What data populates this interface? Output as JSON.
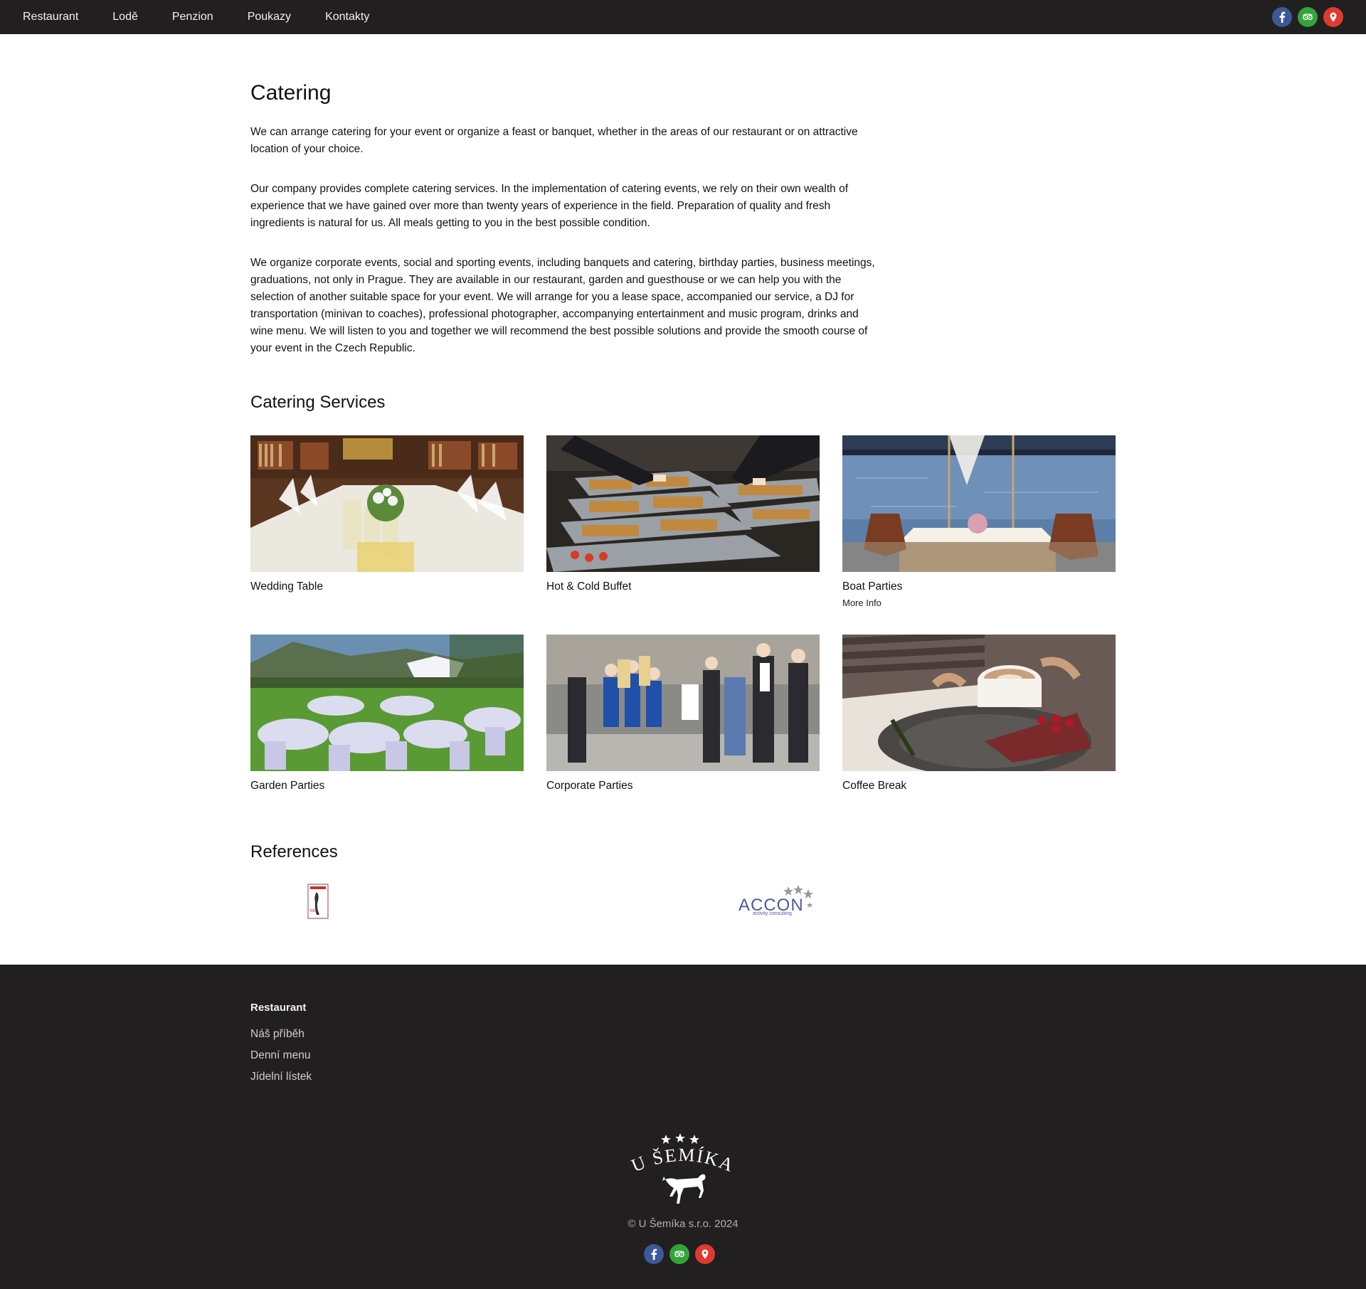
{
  "nav": {
    "items": [
      "Restaurant",
      "Lodě",
      "Penzion",
      "Poukazy",
      "Kontakty"
    ]
  },
  "social": [
    {
      "name": "facebook-icon",
      "color": "#3b5998"
    },
    {
      "name": "tripadvisor-icon",
      "color": "#34a43a"
    },
    {
      "name": "map-pin-icon",
      "color": "#e03a2f"
    }
  ],
  "page": {
    "title": "Catering",
    "paragraphs": [
      "We can arrange catering for your event or organize a feast or banquet, whether in the areas of our restaurant or on attractive location of your choice.",
      "Our company provides complete catering services. In the implementation of catering events, we rely on their own wealth of experience that we have gained over more than twenty years of experience in the field. Preparation of quality and fresh ingredients is natural for us. All meals getting to you in the best possible condition.",
      "We organize corporate events, social and sporting events, including banquets and catering, birthday parties, business meetings, graduations, not only in Prague. They are available in our restaurant, garden and guesthouse or we can help you with the selection of another suitable space for your event. We will arrange for you a lease space, accompanied our service, a DJ for transportation (minivan to coaches), professional photographer, accompanying entertainment and music program, drinks and wine menu. We will listen to you and together we will recommend the best possible solutions and provide the smooth course of your event in the Czech Republic."
    ],
    "services_heading": "Catering Services",
    "services": [
      {
        "title": "Wedding Table",
        "more": ""
      },
      {
        "title": "Hot & Cold Buffet",
        "more": ""
      },
      {
        "title": "Boat Parties",
        "more": "More Info"
      },
      {
        "title": "Garden Parties",
        "more": ""
      },
      {
        "title": "Corporate Parties",
        "more": ""
      },
      {
        "title": "Coffee Break",
        "more": ""
      }
    ],
    "references_heading": "References",
    "references": [
      {
        "name": "reference-logo-1",
        "text": ""
      },
      {
        "name": "accon-logo",
        "text": "ACCON activity consulting"
      }
    ]
  },
  "footer": {
    "column_heading": "Restaurant",
    "links": [
      "Náš příběh",
      "Denní menu",
      "Jídelní lístek"
    ],
    "logo_text": "U ŠEMÍKA",
    "copyright": "© U Šemíka s.r.o. 2024"
  }
}
